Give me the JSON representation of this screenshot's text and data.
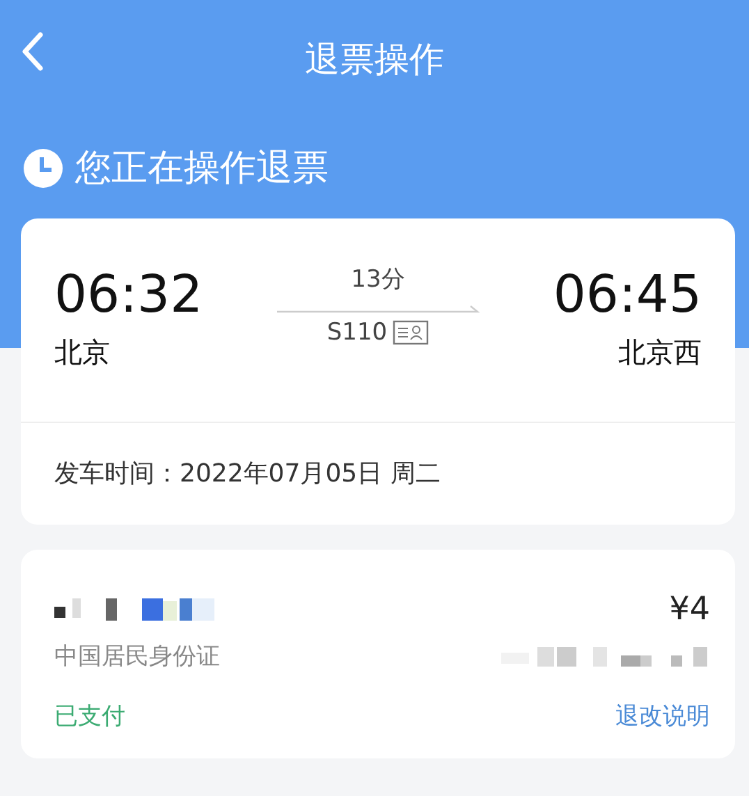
{
  "nav": {
    "title": "退票操作"
  },
  "banner": {
    "text": "您正在操作退票"
  },
  "trip": {
    "depart_time": "06:32",
    "depart_station": "北京",
    "duration": "13分",
    "train_no": "S110",
    "arrive_time": "06:45",
    "arrive_station": "北京西",
    "date_label": "发车时间：",
    "date": "2022年07月05日 周二"
  },
  "passenger": {
    "id_type": "中国居民身份证",
    "price": "¥4",
    "status": "已支付",
    "rules_link": "退改说明"
  }
}
